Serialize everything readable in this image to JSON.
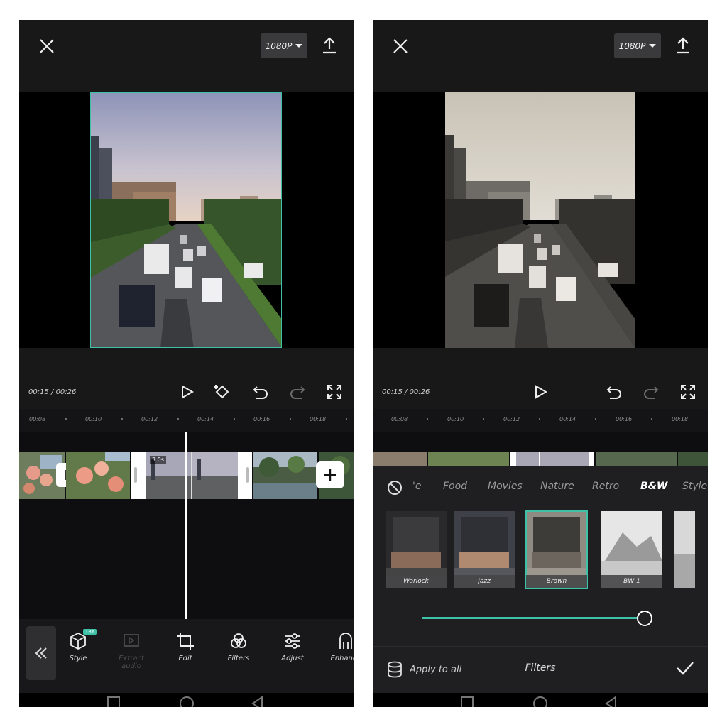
{
  "left_screen": {
    "status_time": "",
    "resolution": "1080P",
    "time_current": "00:15",
    "time_total": "00:26",
    "ruler_ticks": [
      "00:08",
      "00:10",
      "00:12",
      "00:14",
      "00:16",
      "00:18"
    ],
    "clip_label": "3.0s",
    "toolbar": [
      {
        "label": "Style",
        "icon": "cube-icon",
        "badge": "TRY"
      },
      {
        "label": "Extract audio",
        "icon": "extract-audio-icon"
      },
      {
        "label": "Edit",
        "icon": "crop-icon"
      },
      {
        "label": "Filters",
        "icon": "filters-icon"
      },
      {
        "label": "Adjust",
        "icon": "adjust-icon"
      },
      {
        "label": "Enhance",
        "icon": "enhance-icon"
      }
    ]
  },
  "right_screen": {
    "resolution": "1080P",
    "time_current": "00:15",
    "time_total": "00:26",
    "ruler_ticks": [
      "00:08",
      "00:10",
      "00:12",
      "00:14",
      "00:16",
      "00:18"
    ],
    "filter_categories": [
      "'e",
      "Food",
      "Movies",
      "Nature",
      "Retro",
      "B&W",
      "Style"
    ],
    "active_category": "B&W",
    "filters": [
      {
        "label": "Warlock"
      },
      {
        "label": "Jazz"
      },
      {
        "label": "Brown"
      },
      {
        "label": "BW 1"
      }
    ],
    "selected_filter": "Brown",
    "intensity": 1.0,
    "apply_to_all": "Apply to all",
    "panel_title": "Filters"
  },
  "colors": {
    "accent": "#3fc1a8",
    "background": "#0e0e10"
  }
}
